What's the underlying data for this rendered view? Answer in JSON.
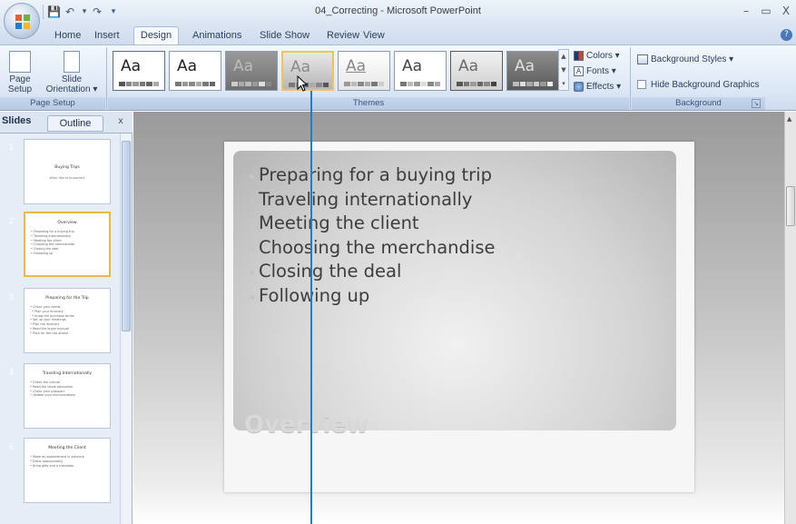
{
  "window": {
    "title": "04_Correcting - Microsoft PowerPoint",
    "min": "–",
    "max": "▭",
    "close": "X"
  },
  "qat": {
    "save": "💾",
    "undo": "↶",
    "redo": "↷",
    "dropdown": "▾",
    "customize": "▾"
  },
  "tabs": {
    "home": "Home",
    "insert": "Insert",
    "design": "Design",
    "animations": "Animations",
    "slideshow": "Slide Show",
    "review": "Review",
    "view": "View",
    "help": "?"
  },
  "ribbon": {
    "page_setup": {
      "page_setup_label": "Page Setup",
      "orientation_label": "Slide Orientation ▾",
      "group_label": "Page Setup"
    },
    "themes": {
      "group_label": "Themes",
      "items": [
        "Aa",
        "Aa",
        "Aa",
        "Aa",
        "Aa",
        "Aa",
        "Aa",
        "Aa"
      ],
      "colors": "Colors ▾",
      "fonts": "Fonts ▾",
      "effects": "Effects ▾"
    },
    "background": {
      "styles": "Background Styles ▾",
      "hide_graphics": "Hide Background Graphics",
      "group_label": "Background"
    }
  },
  "pane": {
    "tab_slides": "Slides",
    "tab_outline": "Outline",
    "close": "x",
    "thumbnails": [
      {
        "num": "1",
        "title": "Buying Trips",
        "lines": "Wide World Importers"
      },
      {
        "num": "2",
        "title": "Overview",
        "lines": "• Preparing for a buying trip\n• Traveling internationally\n• Meeting the client\n• Choosing the merchandise\n• Closing the deal\n• Following up"
      },
      {
        "num": "3",
        "title": "Preparing for the Trip",
        "lines": "• Check your needs\n  • Plan your itinerary\n  • Know the purchase terms\n• Set up your meetings\n• Plan the itinerary\n• Read the buyer manual\n• Pack for the trip ahead"
      },
      {
        "num": "4",
        "title": "Traveling Internationally",
        "lines": "• Check the culture\n• Read the latest advisories\n• Check your passport\n• Update your immunizations"
      },
      {
        "num": "5",
        "title": "Meeting the Client",
        "lines": "• Make an appointment in advance\n• Dress appropriately\n• Bring gifts and a translator"
      }
    ]
  },
  "slide": {
    "bullets": [
      "Preparing for a buying trip",
      "Traveling internationally",
      "Meeting the client",
      "Choosing the merchandise",
      "Closing the deal",
      "Following up"
    ],
    "title": "Overview"
  },
  "colors": {
    "callout_line": "#1d7fc9",
    "selected_thumb_border": "#f0b840",
    "ribbon_bg": "#dce7f5"
  }
}
